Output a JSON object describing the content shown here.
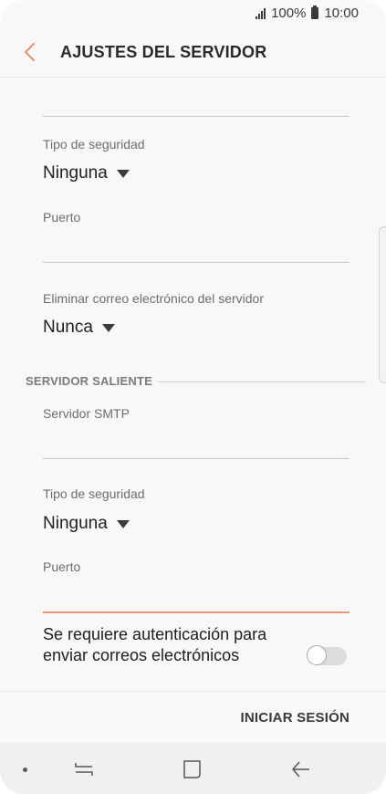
{
  "status_bar": {
    "battery_percent": "100%",
    "time": "10:00"
  },
  "header": {
    "title": "AJUSTES DEL SERVIDOR"
  },
  "incoming": {
    "security_type": {
      "label": "Tipo de seguridad",
      "value": "Ninguna"
    },
    "port": {
      "label": "Puerto",
      "value": ""
    },
    "delete_email": {
      "label": "Eliminar correo electrónico del servidor",
      "value": "Nunca"
    }
  },
  "outgoing": {
    "section_title": "SERVIDOR SALIENTE",
    "smtp_server": {
      "label": "Servidor SMTP",
      "value": ""
    },
    "security_type": {
      "label": "Tipo de seguridad",
      "value": "Ninguna"
    },
    "port": {
      "label": "Puerto",
      "value": ""
    },
    "auth_required": {
      "label": "Se requiere autenticación para enviar correos electrónicos",
      "enabled": false
    }
  },
  "footer": {
    "signin_label": "INICIAR SESIÓN"
  },
  "colors": {
    "accent": "#e89777",
    "background": "#f8f8f8",
    "navbar": "#f0f0f0"
  },
  "icons": {
    "back": "chevron-left-icon",
    "caret": "caret-down-icon",
    "signal": "signal-icon",
    "battery": "battery-icon",
    "recent_apps": "recent-apps-icon",
    "home": "home-icon",
    "back_nav": "back-arrow-icon"
  }
}
